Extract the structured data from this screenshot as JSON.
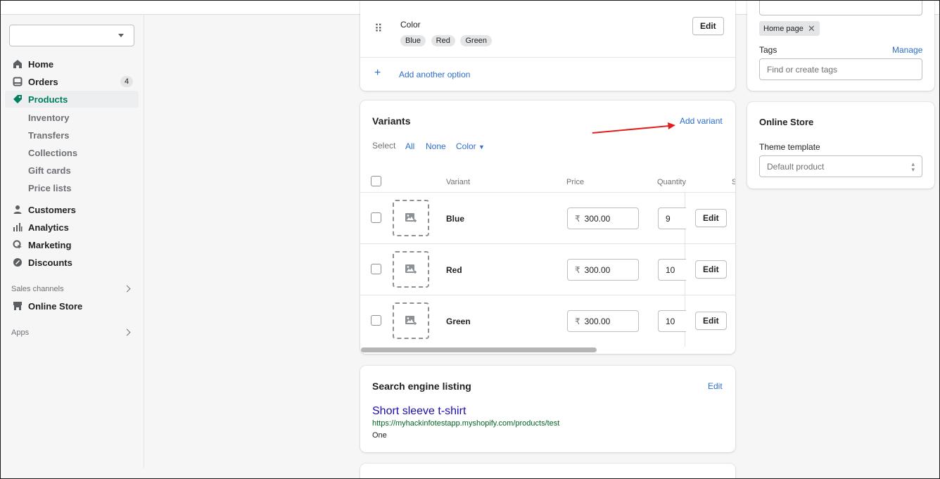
{
  "sidebar": {
    "store_select_value": "",
    "items": [
      {
        "label": "Home",
        "icon": "home-icon"
      },
      {
        "label": "Orders",
        "icon": "orders-icon",
        "badge": "4"
      },
      {
        "label": "Products",
        "icon": "tag-icon",
        "active": true
      }
    ],
    "product_subitems": [
      "Inventory",
      "Transfers",
      "Collections",
      "Gift cards",
      "Price lists"
    ],
    "items2": [
      {
        "label": "Customers",
        "icon": "person-icon"
      },
      {
        "label": "Analytics",
        "icon": "analytics-icon"
      },
      {
        "label": "Marketing",
        "icon": "marketing-icon"
      },
      {
        "label": "Discounts",
        "icon": "discount-icon"
      }
    ],
    "sales_channels_label": "Sales channels",
    "online_store_label": "Online Store",
    "apps_label": "Apps"
  },
  "options": {
    "option_name": "Color",
    "values": [
      "Blue",
      "Red",
      "Green"
    ],
    "edit_label": "Edit",
    "add_option_label": "Add another option"
  },
  "variants": {
    "title": "Variants",
    "add_variant_label": "Add variant",
    "select_label": "Select",
    "select_all": "All",
    "select_none": "None",
    "select_color": "Color",
    "columns": [
      "Variant",
      "Price",
      "Quantity",
      "S"
    ],
    "currency": "₹",
    "rows": [
      {
        "name": "Blue",
        "price": "300.00",
        "quantity": "9",
        "edit": "Edit"
      },
      {
        "name": "Red",
        "price": "300.00",
        "quantity": "10",
        "edit": "Edit"
      },
      {
        "name": "Green",
        "price": "300.00",
        "quantity": "10",
        "edit": "Edit"
      }
    ]
  },
  "seo": {
    "title": "Search engine listing",
    "edit_label": "Edit",
    "page_title": "Short sleeve t-shirt",
    "url": "https://myhackinfotestapp.myshopify.com/products/test",
    "description": "One"
  },
  "organization": {
    "collection_tag": "Home page",
    "tags_label": "Tags",
    "manage_label": "Manage",
    "tags_placeholder": "Find or create tags"
  },
  "online_store": {
    "title": "Online Store",
    "theme_template_label": "Theme template",
    "theme_template_value": "Default product"
  },
  "colors": {
    "accent_link": "#2c6ecb",
    "active_nav": "#007f5f",
    "annotation_arrow": "#e02020",
    "seo_title": "#1a0dab",
    "seo_url": "#006621"
  }
}
